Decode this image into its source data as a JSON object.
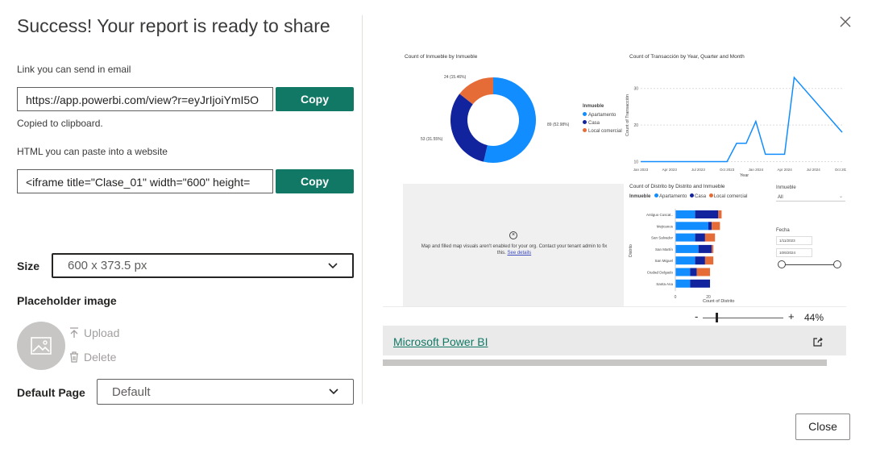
{
  "dialog": {
    "title": "Success! Your report is ready to share",
    "link_label": "Link you can send in email",
    "link_value": "https://app.powerbi.com/view?r=eyJrIjoiYmI5O",
    "copy_label": "Copy",
    "copied_msg": "Copied to clipboard.",
    "html_label": "HTML you can paste into a website",
    "html_value": "<iframe title=\"Clase_01\" width=\"600\" height=",
    "size_label": "Size",
    "size_value": "600 x 373.5 px",
    "placeholder_label": "Placeholder image",
    "upload_label": "Upload",
    "delete_label": "Delete",
    "default_page_label": "Default Page",
    "default_page_value": "Default",
    "close_label": "Close"
  },
  "preview": {
    "donut_title": "Count of Inmueble by Inmueble",
    "donut_labels": [
      "24 (15.46%)",
      "89 (52.98%)",
      "53 (31.55%)"
    ],
    "legend_title": "Inmueble",
    "legend_items": [
      "Apartamento",
      "Casa",
      "Local comercial"
    ],
    "line_title": "Count of Transacción by Year, Quarter and Month",
    "line_ylabel": "Count of Transacción",
    "line_xlabel": "Year",
    "line_yticks": [
      "30",
      "20",
      "10"
    ],
    "line_xticks": [
      "Jan 2023",
      "Apr 2023",
      "Jul 2023",
      "Oct 2023",
      "Jan 2024",
      "Apr 2024",
      "Jul 2024",
      "Oct 2024"
    ],
    "map_msg": "Map and filled map visuals aren't enabled for your org. Contact your tenant admin to fix this.",
    "map_link": "See details",
    "bar_title": "Count of Distrito by Distrito and Inmueble",
    "bar_legend_title": "Inmueble",
    "bar_ylabel": "Distrito",
    "bar_xlabel": "Count of Distrito",
    "bar_categories": [
      "Antiguo Cuscat..",
      "Mejicanos",
      "San Salvador",
      "San Martín",
      "San Miguel",
      "Ciudad Delgado",
      "Santa Ana"
    ],
    "bar_xticks": [
      "0",
      "20"
    ],
    "slicer_inmueble_label": "Inmueble",
    "slicer_inmueble_value": "All",
    "slicer_fecha_label": "Fecha",
    "date_from": "1/11/2023",
    "date_to": "10/6/2024",
    "zoom_minus": "-",
    "zoom_plus": "+",
    "zoom_value": "44%",
    "footer_link": "Microsoft Power BI"
  },
  "chart_data": [
    {
      "type": "pie",
      "title": "Count of Inmueble by Inmueble",
      "categories": [
        "Apartamento",
        "Casa",
        "Local comercial"
      ],
      "values": [
        89,
        53,
        24
      ],
      "colors": [
        "#118DFF",
        "#12239E",
        "#E66C37"
      ]
    },
    {
      "type": "line",
      "title": "Count of Transacción by Year, Quarter and Month",
      "xlabel": "Year",
      "ylabel": "Count of Transacción",
      "ylim": [
        9,
        35
      ],
      "x": [
        "Jan 2023",
        "Feb 2023",
        "Mar 2023",
        "Apr 2023",
        "May 2023",
        "Jun 2023",
        "Jul 2023",
        "Aug 2023",
        "Sep 2023",
        "Oct 2023",
        "Nov 2023",
        "Dec 2023",
        "Jan 2024",
        "Feb 2024",
        "Mar 2024",
        "Apr 2024",
        "May 2024",
        "Jun 2024",
        "Oct 2024"
      ],
      "values": [
        10,
        10,
        10,
        10,
        10,
        10,
        10,
        10,
        10,
        10,
        15,
        15,
        21,
        12,
        12,
        12,
        33,
        30,
        18
      ],
      "color": "#118DFF"
    },
    {
      "type": "bar",
      "title": "Count of Distrito by Distrito and Inmueble",
      "xlabel": "Count of Distrito",
      "ylabel": "Distrito",
      "categories": [
        "Antiguo Cuscat..",
        "Mejicanos",
        "San Salvador",
        "San Martín",
        "San Miguel",
        "Ciudad Delgado",
        "Santa Ana"
      ],
      "series": [
        {
          "name": "Apartamento",
          "values": [
            12,
            20,
            12,
            14,
            12,
            9,
            9
          ]
        },
        {
          "name": "Casa",
          "values": [
            14,
            2,
            6,
            8,
            6,
            4,
            12
          ]
        },
        {
          "name": "Local comercial",
          "values": [
            2,
            5,
            6,
            1,
            5,
            8,
            0
          ]
        }
      ],
      "colors": [
        "#118DFF",
        "#12239E",
        "#E66C37"
      ]
    }
  ]
}
